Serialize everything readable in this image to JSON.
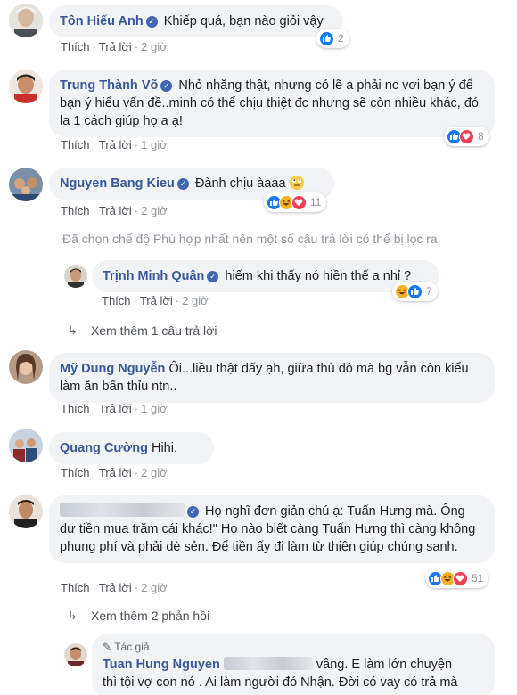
{
  "reaction_colors": {
    "like": "#1877f2",
    "love": "#f33e58",
    "haha": "#f7b125"
  },
  "common": {
    "like": "Thích",
    "reply": "Trả lời",
    "dot": "·"
  },
  "comments": [
    {
      "author": "Tôn Hiếu Anh",
      "text": "Khiếp quá, bạn nào giỏi vậy",
      "time": "2 giờ",
      "reactions": [
        "like"
      ],
      "count": "2"
    },
    {
      "author": "Trung Thành Võ",
      "text": "Nhỏ nhăng thật, nhưng có lẽ a phải nc vơi bạn ý để bạn ý hiểu vấn đề..minh có thể chịu thiệt đc nhưng sẽ còn nhiều khác, đó la 1 cách giúp họ a ạ!",
      "time": "1 giờ",
      "reactions": [
        "like",
        "love"
      ],
      "count": "8"
    },
    {
      "author": "Nguyen Bang Kieu",
      "text": "Đành chịu àaaa",
      "time": "2 giờ",
      "reactions": [
        "like",
        "haha",
        "love"
      ],
      "count": "11",
      "emoji": "rolling-eyes-emoji"
    },
    {
      "author": "Mỹ Dung Nguyễn",
      "text": "Ôi...liều thật đấy ạh, giữa thủ đô mà bg vẫn còn kiểu làm ăn bẩn thỉu ntn..",
      "time": "1 giờ"
    },
    {
      "author": "Quang Cường",
      "text": "Hihi.",
      "time": "2 giờ"
    },
    {
      "author": "J... ...yễn",
      "text": "Họ nghĩ đơn giản chú ạ: Tuấn Hưng mà. Ông dư tiền mua trăm cái khác!\" Họ nào biết càng Tuấn Hưng thì càng không phung phí và phải dè sẻn. Để tiền ấy đi làm từ thiện giúp chúng sanh.",
      "time": "2 giờ",
      "reactions": [
        "like",
        "haha",
        "love"
      ],
      "count": "51"
    }
  ],
  "filtered_notice": "Đã chọn chế độ Phù hợp nhất nên một số câu trả lời có thể bị lọc ra.",
  "reply1": {
    "author": "Trịnh Minh Quân",
    "text": "hiếm khi thấy nó hiền thế a nhỉ ?",
    "time": "2 giờ",
    "count": "7"
  },
  "see_more_1": "Xem thêm 1 câu trả lời",
  "see_more_2": "Xem thêm 2 phản hồi",
  "reply2": {
    "tag": "Tác giả",
    "author": "Tuan Hung Nguyen",
    "text_line1": "vâng. E làm lớn chuyện",
    "text_line2": "thì tội vợ con nó . Ai làm người đó Nhận. Đời có vay có trả mà"
  }
}
